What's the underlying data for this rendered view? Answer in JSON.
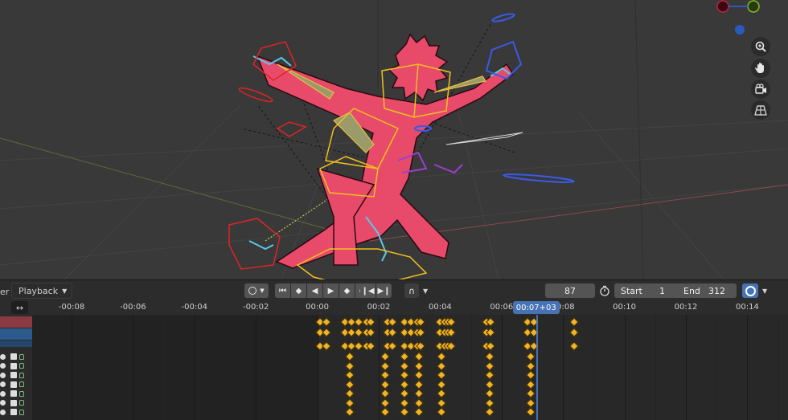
{
  "header": {
    "menu_partial": "er",
    "playback_label": "Playback",
    "current_frame": "87",
    "start_label": "Start",
    "start_value": "1",
    "end_label": "End",
    "end_value": "312"
  },
  "timeline": {
    "ticks": [
      {
        "label": "-00:08",
        "pos": 0
      },
      {
        "label": "-00:06",
        "pos": 1
      },
      {
        "label": "-00:04",
        "pos": 2
      },
      {
        "label": "-00:02",
        "pos": 3
      },
      {
        "label": "00:00",
        "pos": 4
      },
      {
        "label": "00:02",
        "pos": 5
      },
      {
        "label": "00:04",
        "pos": 6
      },
      {
        "label": "00:06",
        "pos": 7
      },
      {
        "label": "00:08",
        "pos": 8
      },
      {
        "label": "00:10",
        "pos": 9
      },
      {
        "label": "00:12",
        "pos": 10
      },
      {
        "label": "00:14",
        "pos": 11
      }
    ],
    "current_time_label": "00:07+03",
    "current_time_seconds": 7.125
  },
  "channels": {
    "row_count": 7
  },
  "keyframes": {
    "summary_seconds": [
      0.1,
      0.3,
      0.9,
      1.1,
      1.35,
      1.6,
      1.75,
      2.3,
      2.45,
      2.85,
      3.05,
      3.25,
      3.35,
      4.0,
      4.15,
      4.25,
      4.35,
      5.5,
      5.65,
      6.85,
      7.05,
      8.35
    ],
    "channel_seconds": [
      1.05,
      2.2,
      2.85,
      3.3,
      4.05,
      5.6,
      6.95
    ]
  },
  "colors": {
    "accent": "#4772b3",
    "keyframe": "#f0b429",
    "channel_red": "#8a3a42",
    "channel_blue": "#2d5a8c"
  },
  "icons": [
    "zoom-icon",
    "hand-pan-icon",
    "camera-icon",
    "grid-view-icon",
    "stopwatch-icon",
    "render-preview-icon",
    "swap-arrows-icon"
  ]
}
